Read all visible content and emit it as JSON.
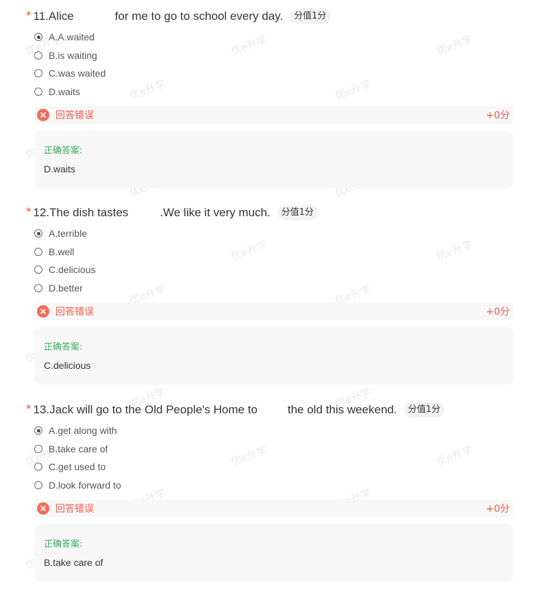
{
  "watermark_text": "优e升学",
  "colors": {
    "required_star": "#f5483b",
    "wrong": "#ef5a4c",
    "correct_title": "#3bab63",
    "panel_bg": "#f7f7f7"
  },
  "questions": [
    {
      "number": "11.",
      "text_before": "Alice",
      "text_after": "for me to go to school every day.",
      "score": "分值1分",
      "options": [
        {
          "label": "A.A.waited",
          "selected": true
        },
        {
          "label": "B.is waiting",
          "selected": false
        },
        {
          "label": "C.was waited",
          "selected": false
        },
        {
          "label": "D.waits",
          "selected": false
        }
      ],
      "result": "回答错误",
      "points": "+0分",
      "answer_title": "正确答案:",
      "answer": "D.waits"
    },
    {
      "number": "12.",
      "text_before": "The dish tastes",
      "text_after": ".We like it very much.",
      "score": "分值1分",
      "options": [
        {
          "label": "A.terrible",
          "selected": true
        },
        {
          "label": "B.well",
          "selected": false
        },
        {
          "label": "C.delicious",
          "selected": false
        },
        {
          "label": "D.better",
          "selected": false
        }
      ],
      "result": "回答错误",
      "points": "+0分",
      "answer_title": "正确答案:",
      "answer": "C.delicious"
    },
    {
      "number": "13.",
      "text_before": "Jack will go to the Old People's Home to",
      "text_after": "the old this weekend.",
      "score": "分值1分",
      "options": [
        {
          "label": "A.get along with",
          "selected": true
        },
        {
          "label": "B.take care of",
          "selected": false
        },
        {
          "label": "C.get used to",
          "selected": false
        },
        {
          "label": "D.look forward to",
          "selected": false
        }
      ],
      "result": "回答错误",
      "points": "+0分",
      "answer_title": "正确答案:",
      "answer": "B.take care of"
    }
  ]
}
